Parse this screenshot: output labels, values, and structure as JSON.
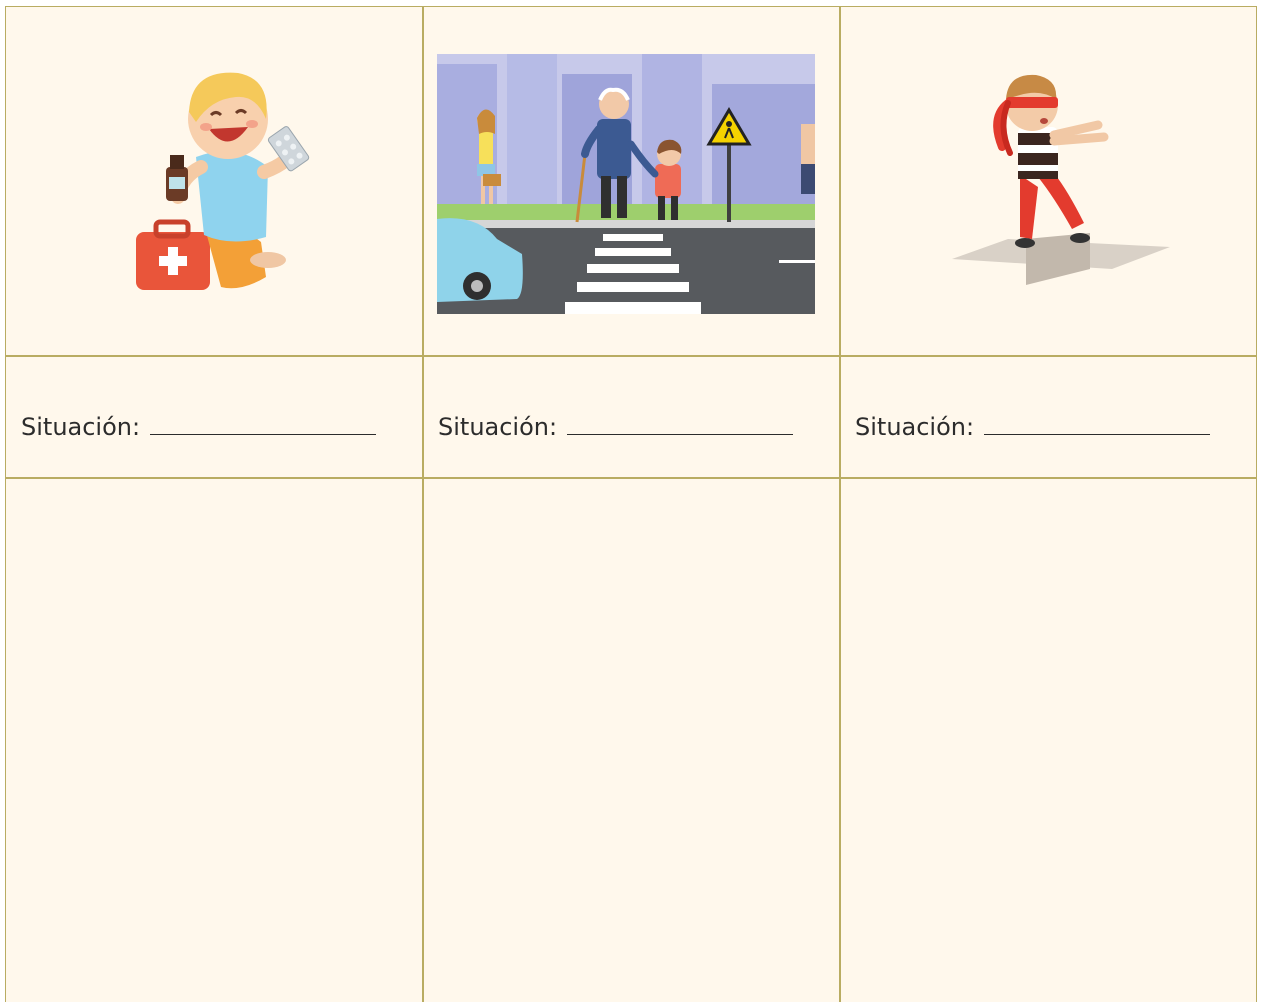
{
  "colors": {
    "page_bg": "#fff8ec",
    "grid_line": "#b9ac62",
    "text": "#2c2c2c"
  },
  "illustrations": [
    {
      "icon": "child-with-medicine-icon"
    },
    {
      "icon": "street-crossing-scene-icon"
    },
    {
      "icon": "blindfolded-child-icon"
    }
  ],
  "situations": [
    {
      "label": "Situación:"
    },
    {
      "label": "Situación:"
    },
    {
      "label": "Situación:"
    }
  ]
}
